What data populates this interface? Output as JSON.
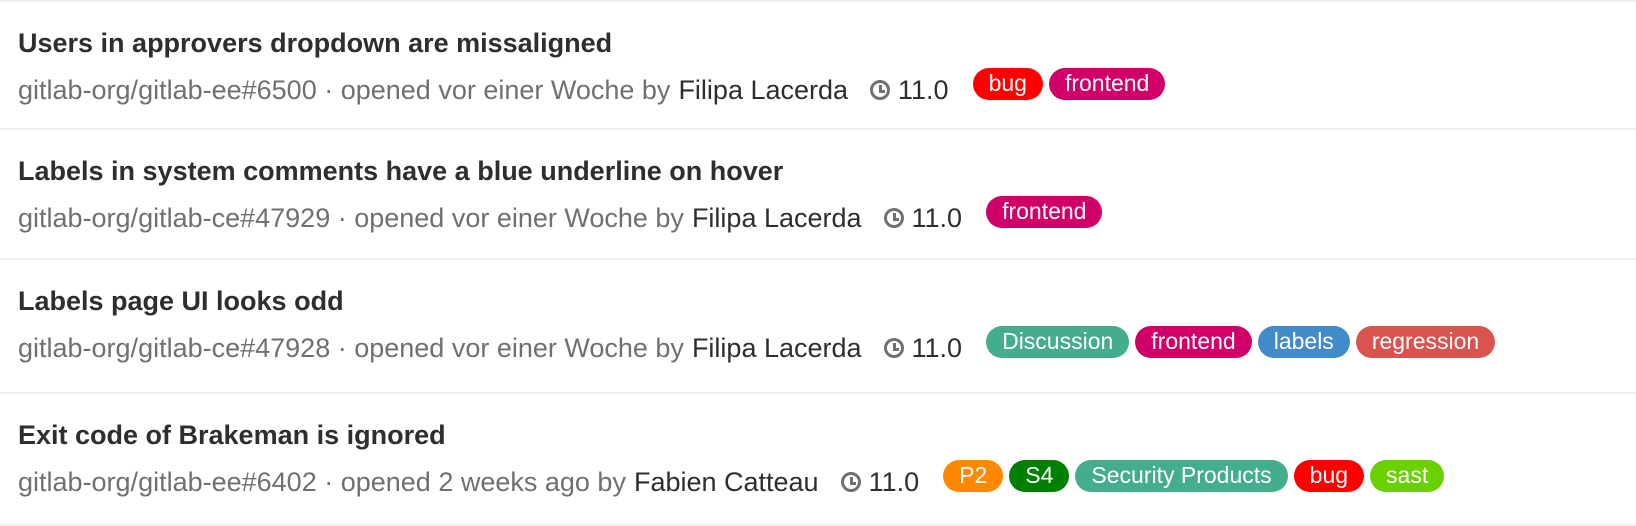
{
  "issues": [
    {
      "title": "Users in approvers dropdown are missaligned",
      "reference": "gitlab-org/gitlab-ee#6500",
      "opened": "· opened vor einer Woche by",
      "author": "Filipa Lacerda",
      "milestone_icon": "clock-icon",
      "milestone": "11.0",
      "labels": [
        {
          "text": "bug",
          "color": "#ff0000"
        },
        {
          "text": "frontend",
          "color": "#d10069"
        }
      ]
    },
    {
      "title": "Labels in system comments have a blue underline on hover",
      "reference": "gitlab-org/gitlab-ce#47929",
      "opened": "· opened vor einer Woche by",
      "author": "Filipa Lacerda",
      "milestone_icon": "clock-icon",
      "milestone": "11.0",
      "labels": [
        {
          "text": "frontend",
          "color": "#d10069"
        }
      ]
    },
    {
      "title": "Labels page UI looks odd",
      "reference": "gitlab-org/gitlab-ce#47928",
      "opened": "· opened vor einer Woche by",
      "author": "Filipa Lacerda",
      "milestone_icon": "clock-icon",
      "milestone": "11.0",
      "labels": [
        {
          "text": "Discussion",
          "color": "#44ad8e"
        },
        {
          "text": "frontend",
          "color": "#d10069"
        },
        {
          "text": "labels",
          "color": "#428bca"
        },
        {
          "text": "regression",
          "color": "#d9534f"
        }
      ]
    },
    {
      "title": "Exit code of Brakeman is ignored",
      "reference": "gitlab-org/gitlab-ee#6402",
      "opened": "· opened 2 weeks ago by",
      "author": "Fabien Catteau",
      "milestone_icon": "clock-icon",
      "milestone": "11.0",
      "labels": [
        {
          "text": "P2",
          "color": "#ff8800"
        },
        {
          "text": "S4",
          "color": "#008000"
        },
        {
          "text": "Security Products",
          "color": "#44ad8e"
        },
        {
          "text": "bug",
          "color": "#ff0000"
        },
        {
          "text": "sast",
          "color": "#69d100"
        }
      ]
    }
  ]
}
